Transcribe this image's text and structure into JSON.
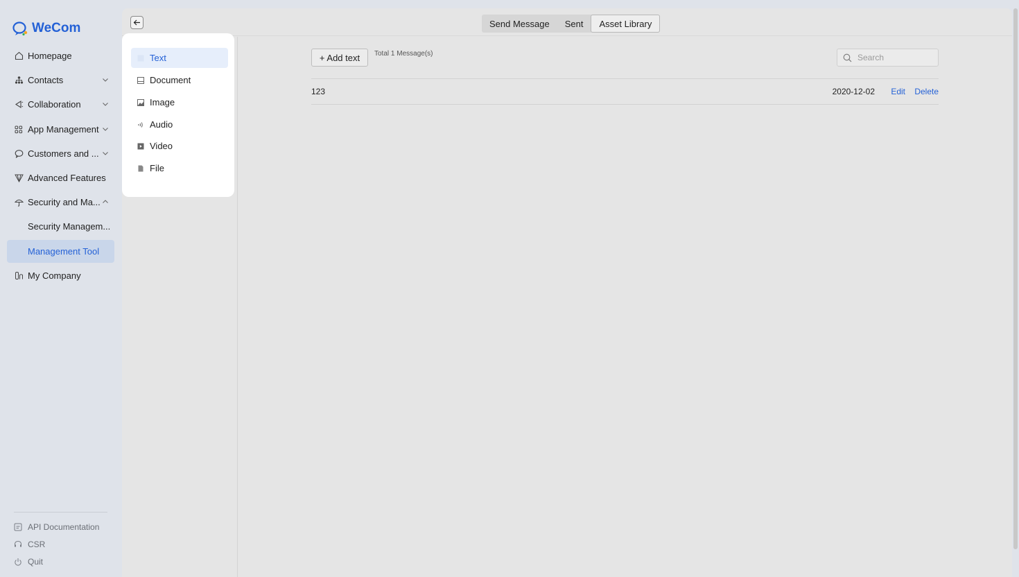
{
  "app": {
    "logo_text": "WeCom"
  },
  "sidebar": {
    "items": [
      {
        "label": "Homepage",
        "icon": "home-icon"
      },
      {
        "label": "Contacts",
        "icon": "org-chart-icon",
        "expandable": true
      },
      {
        "label": "Collaboration",
        "icon": "collaboration-icon",
        "expandable": true
      },
      {
        "label": "App Management",
        "icon": "apps-grid-icon",
        "expandable": true
      },
      {
        "label": "Customers and ...",
        "icon": "chat-bubble-icon",
        "expandable": true
      },
      {
        "label": "Advanced Features",
        "icon": "diamond-icon"
      },
      {
        "label": "Security and Ma...",
        "icon": "umbrella-icon",
        "expanded": true
      },
      {
        "label": "Security Managem..."
      },
      {
        "label": "Management Tool",
        "active": true
      },
      {
        "label": "My Company",
        "icon": "company-icon"
      }
    ],
    "footer": [
      {
        "label": "API Documentation",
        "icon": "document-icon"
      },
      {
        "label": "CSR",
        "icon": "headset-icon"
      },
      {
        "label": "Quit",
        "icon": "power-icon"
      }
    ]
  },
  "topbar": {
    "tabs": [
      {
        "label": "Send Message"
      },
      {
        "label": "Sent"
      },
      {
        "label": "Asset Library",
        "active": true
      }
    ]
  },
  "categories": [
    {
      "label": "Text",
      "icon": "text-icon",
      "active": true
    },
    {
      "label": "Document",
      "icon": "document-icon"
    },
    {
      "label": "Image",
      "icon": "image-icon"
    },
    {
      "label": "Audio",
      "icon": "audio-icon"
    },
    {
      "label": "Video",
      "icon": "video-icon"
    },
    {
      "label": "File",
      "icon": "file-icon"
    }
  ],
  "content": {
    "add_button": "+ Add text",
    "total": "Total 1 Message(s)",
    "search_placeholder": "Search",
    "rows": [
      {
        "content": "123",
        "date": "2020-12-02",
        "edit": "Edit",
        "delete": "Delete"
      }
    ]
  },
  "colors": {
    "accent": "#2461d6",
    "sidebar_bg": "#dfe3ea",
    "panel_bg": "#e5e5e5",
    "active_nav_bg": "#c9d6ea"
  }
}
